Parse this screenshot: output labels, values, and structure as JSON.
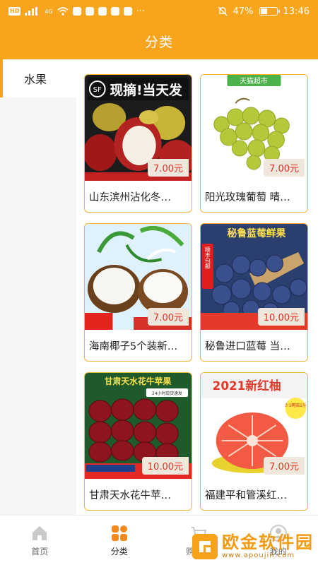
{
  "status_bar": {
    "network_left": "HD",
    "signal_label": "4G",
    "more": "···",
    "battery_percent": "47%",
    "battery_level": 0.47,
    "time": "13:46"
  },
  "header": {
    "title": "分类"
  },
  "sidebar": {
    "items": [
      {
        "label": "水果"
      }
    ]
  },
  "products": [
    {
      "title": "山东滨州沾化冬…",
      "price": "7.00元",
      "banner": "现摘!当天发",
      "badge": "SF"
    },
    {
      "title": "阳光玫瑰葡萄 晴…",
      "price": "7.00元",
      "banner": "天猫超市"
    },
    {
      "title": "海南椰子5个装新…",
      "price": "7.00元"
    },
    {
      "title": "秘鲁进口蓝莓 当…",
      "price": "10.00元",
      "banner": "秘鲁蓝莓鲜果",
      "badge": "顺丰包邮"
    },
    {
      "title": "甘肃天水花牛苹…",
      "price": "10.00元",
      "banner": "甘肃天水花牛苹果",
      "sub_banner": "24小时现货速发"
    },
    {
      "title": "福建平和管溪红…",
      "price": "7.00元",
      "banner": "2021新红柚",
      "badge": "少1两赔1斤"
    }
  ],
  "tabbar": {
    "tabs": [
      {
        "label": "首页",
        "icon": "home-icon"
      },
      {
        "label": "分类",
        "icon": "category-icon"
      },
      {
        "label": "购物车",
        "icon": "cart-icon"
      },
      {
        "label": "我的",
        "icon": "profile-icon"
      }
    ]
  },
  "watermark": {
    "text": "欧金软件园",
    "url": "www.apoujin.com"
  },
  "colors": {
    "brand": "#f8a41d",
    "price": "#e52f20",
    "card_border": "#f2b23a"
  }
}
